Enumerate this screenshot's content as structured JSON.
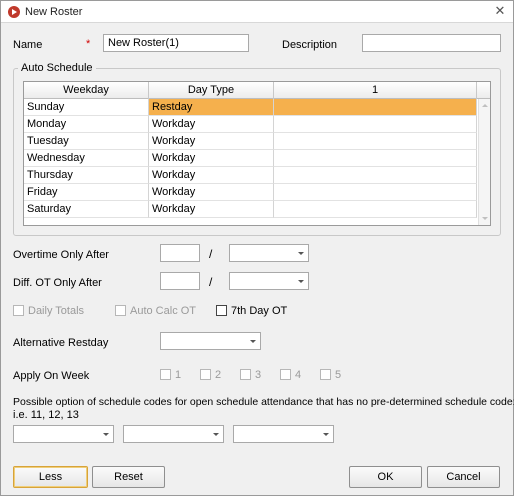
{
  "window": {
    "title": "New Roster"
  },
  "form": {
    "name_label": "Name",
    "required_mark": "*",
    "name_value": "New Roster(1)",
    "description_label": "Description",
    "description_value": ""
  },
  "auto_schedule": {
    "group_title": "Auto Schedule",
    "columns": [
      "Weekday",
      "Day Type",
      "1"
    ],
    "rows": [
      {
        "weekday": "Sunday",
        "day_type": "Restday",
        "selected": true
      },
      {
        "weekday": "Monday",
        "day_type": "Workday"
      },
      {
        "weekday": "Tuesday",
        "day_type": "Workday"
      },
      {
        "weekday": "Wednesday",
        "day_type": "Workday"
      },
      {
        "weekday": "Thursday",
        "day_type": "Workday"
      },
      {
        "weekday": "Friday",
        "day_type": "Workday"
      },
      {
        "weekday": "Saturday",
        "day_type": "Workday"
      }
    ]
  },
  "overtime": {
    "ot_only_after_label": "Overtime Only After",
    "diff_ot_only_after_label": "Diff. OT Only After",
    "separator": "/"
  },
  "options": {
    "daily_totals": "Daily Totals",
    "auto_calc_ot": "Auto Calc OT",
    "seventh_day_ot": "7th Day OT"
  },
  "alternative_restday_label": "Alternative Restday",
  "apply_on_week": {
    "label": "Apply On Week",
    "weeks": [
      "1",
      "2",
      "3",
      "4",
      "5"
    ]
  },
  "schedule_codes": {
    "description_line1": "Possible option of schedule codes for open schedule attendance that has no pre-determined schedule code:-",
    "description_line2": "i.e. 11, 12, 13"
  },
  "buttons": {
    "less": "Less",
    "reset": "Reset",
    "ok": "OK",
    "cancel": "Cancel"
  },
  "colors": {
    "selected_row": "#f5b04d",
    "focused_button_border": "#d7a33a"
  }
}
